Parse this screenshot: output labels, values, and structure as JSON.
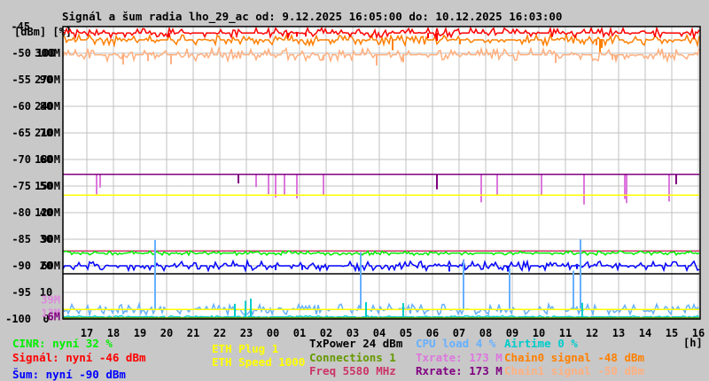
{
  "title": "Signál a šum radia lho_29_ac od: 9.12.2025 16:05:00 do: 10.12.2025 16:03:00",
  "chart_data": {
    "type": "line",
    "title": "Signál a šum radia lho_29_ac od: 9.12.2025 16:05:00 do: 10.12.2025 16:03:00",
    "units_header": "[dBm] [%]",
    "xlabel": "[h]",
    "ylim": [
      -100,
      -45
    ],
    "grid": true,
    "x_ticks": [
      "17",
      "18",
      "19",
      "20",
      "21",
      "22",
      "23",
      "00",
      "01",
      "02",
      "03",
      "04",
      "05",
      "06",
      "07",
      "08",
      "09",
      "10",
      "11",
      "12",
      "13",
      "14",
      "15",
      "16"
    ],
    "y_ticks": [
      {
        "dbm": "-45",
        "pct": "",
        "rate": "",
        "v": -45
      },
      {
        "dbm": "-50",
        "pct": "100",
        "rate": "300M",
        "v": -50
      },
      {
        "dbm": "-55",
        "pct": "90",
        "rate": "270M",
        "v": -55
      },
      {
        "dbm": "-60",
        "pct": "80",
        "rate": "240M",
        "v": -60
      },
      {
        "dbm": "-65",
        "pct": "70",
        "rate": "210M",
        "v": -65
      },
      {
        "dbm": "-70",
        "pct": "60",
        "rate": "180M",
        "v": -70
      },
      {
        "dbm": "-75",
        "pct": "50",
        "rate": "150M",
        "v": -75
      },
      {
        "dbm": "-80",
        "pct": "40",
        "rate": "120M",
        "v": -80
      },
      {
        "dbm": "-85",
        "pct": "30",
        "rate": "90M",
        "v": -85
      },
      {
        "dbm": "-90",
        "pct": "20",
        "rate": "60M",
        "v": -90
      },
      {
        "dbm": "-95",
        "pct": "10",
        "rate": "",
        "v": -95
      },
      {
        "dbm": "-100",
        "pct": "0",
        "rate": "",
        "v": -100
      }
    ],
    "extra_rate_labels": [
      {
        "text": "39M",
        "color": "#dd88dd",
        "v": -96.4
      },
      {
        "text": "13M",
        "color": "#dd88dd",
        "v": -98.9
      },
      {
        "text": "6M",
        "color": "#800080",
        "v": -99.6
      }
    ],
    "series": [
      {
        "name": "Chain1 signal",
        "color": "#ffb080",
        "base": -50.3,
        "jitter": 1.2,
        "spikes": 0.02,
        "spike": -2
      },
      {
        "name": "Chain0 signal",
        "color": "#ff8000",
        "base": -47.5,
        "jitter": 1.0,
        "spikes": 0.01,
        "spike": -2
      },
      {
        "name": "Signál",
        "color": "#ff0000",
        "base": -46.2,
        "jitter": 0.9,
        "spikes": 0.01,
        "spike": -1.5
      },
      {
        "name": "Txrate",
        "color": "#dd77dd",
        "base": -72.8,
        "jitter": 0,
        "spikes": 0.03,
        "spike": -5
      },
      {
        "name": "Rxrate",
        "color": "#800080",
        "base": -72.8,
        "jitter": 0,
        "spikes": 0.005,
        "spike": -3
      },
      {
        "name": "ETH Speed",
        "color": "#ffff00",
        "base": -76.7,
        "jitter": 0,
        "spikes": 0,
        "spike": 0
      },
      {
        "name": "Freq",
        "color": "#cc3366",
        "base": -87.2,
        "jitter": 0,
        "spikes": 0,
        "spike": 0
      },
      {
        "name": "CINR",
        "color": "#00ee00",
        "base": -87.6,
        "jitter": 0.4,
        "spikes": 0,
        "spike": 0
      },
      {
        "name": "TxPower",
        "color": "#000000",
        "base": -91.5,
        "jitter": 0,
        "spikes": 0,
        "spike": 0
      },
      {
        "name": "Šum",
        "color": "#0000ff",
        "base": -90,
        "jitter": 0.9,
        "spikes": 0.01,
        "spike": -1
      },
      {
        "name": "CPU load",
        "color": "#66b0ff",
        "base": -98.2,
        "jitter": 1.0,
        "spikes": 0.03,
        "spike": 12
      },
      {
        "name": "ETH Plug",
        "color": "#ffff00",
        "base": -98.2,
        "jitter": 0,
        "spikes": 0,
        "spike": 0
      },
      {
        "name": "Airtime",
        "color": "#00cccc",
        "base": -99.6,
        "jitter": 0.2,
        "spikes": 0.02,
        "spike": 3
      },
      {
        "name": "Connections",
        "color": "#669900",
        "base": -99.8,
        "jitter": 0,
        "spikes": 0,
        "spike": 0
      }
    ]
  },
  "legend": {
    "cinr": {
      "text": "CINR: nyní 32 %",
      "color": "#00ee00"
    },
    "signal": {
      "text": "Signál: nyní -46 dBm",
      "color": "#ff0000"
    },
    "noise": {
      "text": "Šum: nyní -90 dBm",
      "color": "#0000ff"
    },
    "eth_plug": {
      "text": "ETH Plug 1",
      "color": "#ffff00"
    },
    "eth_speed": {
      "text": "ETH Speed 1000",
      "color": "#ffff00"
    },
    "txpower": {
      "text": "TxPower 24 dBm",
      "color": "#000000"
    },
    "connections": {
      "text": "Connections 1",
      "color": "#669900"
    },
    "freq": {
      "text": "Freq 5580 MHz",
      "color": "#cc3366"
    },
    "cpu": {
      "text": "CPU load 4 %",
      "color": "#66b0ff"
    },
    "txrate": {
      "text": "Txrate: 173 M",
      "color": "#dd77dd"
    },
    "rxrate": {
      "text": "Rxrate: 173 M",
      "color": "#800080"
    },
    "airtime": {
      "text": "Airtime 0 %",
      "color": "#00cccc"
    },
    "chain0": {
      "text": "Chain0 signal -48 dBm",
      "color": "#ff8000"
    },
    "chain1": {
      "text": "Chain1 signal -50 dBm",
      "color": "#ffb080"
    }
  }
}
